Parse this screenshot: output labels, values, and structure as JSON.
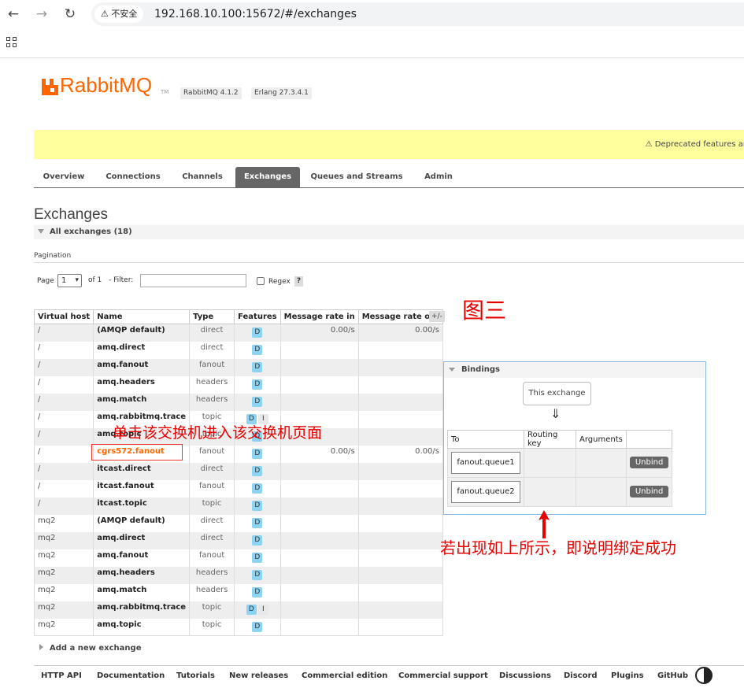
{
  "browser": {
    "security_label": "不安全",
    "url": "192.168.10.100:15672/#/exchanges"
  },
  "header": {
    "logo_text": "RabbitMQ",
    "tm": "TM",
    "rabbitmq_version": "RabbitMQ 4.1.2",
    "erlang_version": "Erlang 27.3.4.1"
  },
  "warning_banner": "⚠ Deprecated features ar",
  "tabs": [
    "Overview",
    "Connections",
    "Channels",
    "Exchanges",
    "Queues and Streams",
    "Admin"
  ],
  "active_tab": "Exchanges",
  "page_title": "Exchanges",
  "all_exchanges_label": "All exchanges (18)",
  "pagination": {
    "label": "Pagination",
    "page_label": "Page",
    "page_value": "1",
    "of_label": "of 1",
    "filter_label": "- Filter:",
    "regex_label": "Regex",
    "help": "?"
  },
  "table": {
    "headers": [
      "Virtual host",
      "Name",
      "Type",
      "Features",
      "Message rate in",
      "Message rate out"
    ],
    "plus_minus": "+/-",
    "rows": [
      {
        "vhost": "/",
        "name": "(AMQP default)",
        "type": "direct",
        "features": [
          "D"
        ],
        "rate_in": "0.00/s",
        "rate_out": "0.00/s"
      },
      {
        "vhost": "/",
        "name": "amq.direct",
        "type": "direct",
        "features": [
          "D"
        ],
        "rate_in": "",
        "rate_out": ""
      },
      {
        "vhost": "/",
        "name": "amq.fanout",
        "type": "fanout",
        "features": [
          "D"
        ],
        "rate_in": "",
        "rate_out": ""
      },
      {
        "vhost": "/",
        "name": "amq.headers",
        "type": "headers",
        "features": [
          "D"
        ],
        "rate_in": "",
        "rate_out": ""
      },
      {
        "vhost": "/",
        "name": "amq.match",
        "type": "headers",
        "features": [
          "D"
        ],
        "rate_in": "",
        "rate_out": ""
      },
      {
        "vhost": "/",
        "name": "amq.rabbitmq.trace",
        "type": "topic",
        "features": [
          "D",
          "I"
        ],
        "rate_in": "",
        "rate_out": ""
      },
      {
        "vhost": "/",
        "name": "amq.topic",
        "type": "topic",
        "features": [
          "D"
        ],
        "rate_in": "",
        "rate_out": ""
      },
      {
        "vhost": "/",
        "name": "cgrs572.fanout",
        "type": "fanout",
        "features": [
          "D"
        ],
        "rate_in": "0.00/s",
        "rate_out": "0.00/s"
      },
      {
        "vhost": "/",
        "name": "itcast.direct",
        "type": "direct",
        "features": [
          "D"
        ],
        "rate_in": "",
        "rate_out": ""
      },
      {
        "vhost": "/",
        "name": "itcast.fanout",
        "type": "fanout",
        "features": [
          "D"
        ],
        "rate_in": "",
        "rate_out": ""
      },
      {
        "vhost": "/",
        "name": "itcast.topic",
        "type": "topic",
        "features": [
          "D"
        ],
        "rate_in": "",
        "rate_out": ""
      },
      {
        "vhost": "mq2",
        "name": "(AMQP default)",
        "type": "direct",
        "features": [
          "D"
        ],
        "rate_in": "",
        "rate_out": ""
      },
      {
        "vhost": "mq2",
        "name": "amq.direct",
        "type": "direct",
        "features": [
          "D"
        ],
        "rate_in": "",
        "rate_out": ""
      },
      {
        "vhost": "mq2",
        "name": "amq.fanout",
        "type": "fanout",
        "features": [
          "D"
        ],
        "rate_in": "",
        "rate_out": ""
      },
      {
        "vhost": "mq2",
        "name": "amq.headers",
        "type": "headers",
        "features": [
          "D"
        ],
        "rate_in": "",
        "rate_out": ""
      },
      {
        "vhost": "mq2",
        "name": "amq.match",
        "type": "headers",
        "features": [
          "D"
        ],
        "rate_in": "",
        "rate_out": ""
      },
      {
        "vhost": "mq2",
        "name": "amq.rabbitmq.trace",
        "type": "topic",
        "features": [
          "D",
          "I"
        ],
        "rate_in": "",
        "rate_out": ""
      },
      {
        "vhost": "mq2",
        "name": "amq.topic",
        "type": "topic",
        "features": [
          "D"
        ],
        "rate_in": "",
        "rate_out": ""
      }
    ]
  },
  "annotations": {
    "figure_label": "图三",
    "click_hint": "单击该交换机进入该交换机页面",
    "success_hint": "若出现如上所示，即说明绑定成功"
  },
  "bindings": {
    "title": "Bindings",
    "this_exchange": "This exchange",
    "arrow": "⇓",
    "headers": [
      "To",
      "Routing key",
      "Arguments",
      ""
    ],
    "rows": [
      {
        "to": "fanout.queue1",
        "routing_key": "",
        "arguments": "",
        "action": "Unbind"
      },
      {
        "to": "fanout.queue2",
        "routing_key": "",
        "arguments": "",
        "action": "Unbind"
      }
    ]
  },
  "add_exchange": "Add a new exchange",
  "footer": [
    "HTTP API",
    "Documentation",
    "Tutorials",
    "New releases",
    "Commercial edition",
    "Commercial support",
    "Discussions",
    "Discord",
    "Plugins",
    "GitHub"
  ],
  "colors": {
    "brand": "#ff6600",
    "annotation": "#e60000",
    "active_tab": "#666666",
    "badge": "#8dd3f2",
    "banner": "#ffff9e"
  }
}
